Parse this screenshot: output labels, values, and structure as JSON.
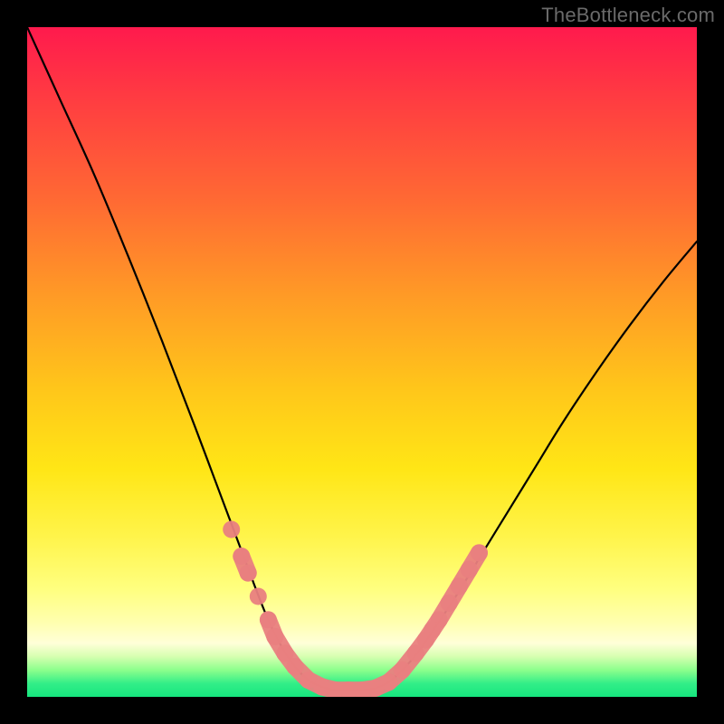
{
  "watermark": "TheBottleneck.com",
  "chart_data": {
    "type": "line",
    "title": "",
    "xlabel": "",
    "ylabel": "",
    "xlim": [
      0,
      100
    ],
    "ylim": [
      0,
      100
    ],
    "curve": {
      "name": "bottleneck-curve",
      "points": [
        {
          "x": 0.0,
          "y": 100.0
        },
        {
          "x": 5.0,
          "y": 89.0
        },
        {
          "x": 10.0,
          "y": 78.0
        },
        {
          "x": 15.0,
          "y": 66.0
        },
        {
          "x": 20.0,
          "y": 53.5
        },
        {
          "x": 25.0,
          "y": 40.5
        },
        {
          "x": 28.0,
          "y": 32.5
        },
        {
          "x": 31.0,
          "y": 24.5
        },
        {
          "x": 34.0,
          "y": 16.5
        },
        {
          "x": 36.0,
          "y": 11.5
        },
        {
          "x": 38.0,
          "y": 7.5
        },
        {
          "x": 40.0,
          "y": 4.5
        },
        {
          "x": 42.0,
          "y": 2.5
        },
        {
          "x": 44.0,
          "y": 1.5
        },
        {
          "x": 46.0,
          "y": 1.0
        },
        {
          "x": 48.0,
          "y": 1.0
        },
        {
          "x": 50.0,
          "y": 1.0
        },
        {
          "x": 52.0,
          "y": 1.3
        },
        {
          "x": 54.0,
          "y": 2.2
        },
        {
          "x": 56.0,
          "y": 4.0
        },
        {
          "x": 58.0,
          "y": 6.2
        },
        {
          "x": 60.0,
          "y": 9.0
        },
        {
          "x": 64.0,
          "y": 15.0
        },
        {
          "x": 68.0,
          "y": 21.5
        },
        {
          "x": 72.0,
          "y": 28.0
        },
        {
          "x": 76.0,
          "y": 34.5
        },
        {
          "x": 80.0,
          "y": 41.0
        },
        {
          "x": 85.0,
          "y": 48.5
        },
        {
          "x": 90.0,
          "y": 55.5
        },
        {
          "x": 95.0,
          "y": 62.0
        },
        {
          "x": 100.0,
          "y": 68.0
        }
      ]
    },
    "markers": {
      "name": "highlight-markers",
      "color": "#e98080",
      "points": [
        {
          "x": 30.5,
          "y": 25.0
        },
        {
          "x": 32.0,
          "y": 21.0
        },
        {
          "x": 33.0,
          "y": 18.5
        },
        {
          "x": 34.5,
          "y": 15.0
        },
        {
          "x": 36.0,
          "y": 11.5
        },
        {
          "x": 37.0,
          "y": 9.0
        },
        {
          "x": 38.5,
          "y": 6.5
        },
        {
          "x": 40.0,
          "y": 4.5
        },
        {
          "x": 42.0,
          "y": 2.5
        },
        {
          "x": 44.0,
          "y": 1.5
        },
        {
          "x": 46.0,
          "y": 1.0
        },
        {
          "x": 48.0,
          "y": 1.0
        },
        {
          "x": 50.0,
          "y": 1.0
        },
        {
          "x": 52.0,
          "y": 1.3
        },
        {
          "x": 54.0,
          "y": 2.2
        },
        {
          "x": 56.0,
          "y": 4.0
        },
        {
          "x": 58.0,
          "y": 6.5
        },
        {
          "x": 59.5,
          "y": 8.5
        },
        {
          "x": 60.5,
          "y": 10.0
        },
        {
          "x": 61.5,
          "y": 11.5
        },
        {
          "x": 63.0,
          "y": 14.0
        },
        {
          "x": 64.5,
          "y": 16.5
        },
        {
          "x": 66.0,
          "y": 19.0
        },
        {
          "x": 67.5,
          "y": 21.5
        }
      ]
    }
  }
}
